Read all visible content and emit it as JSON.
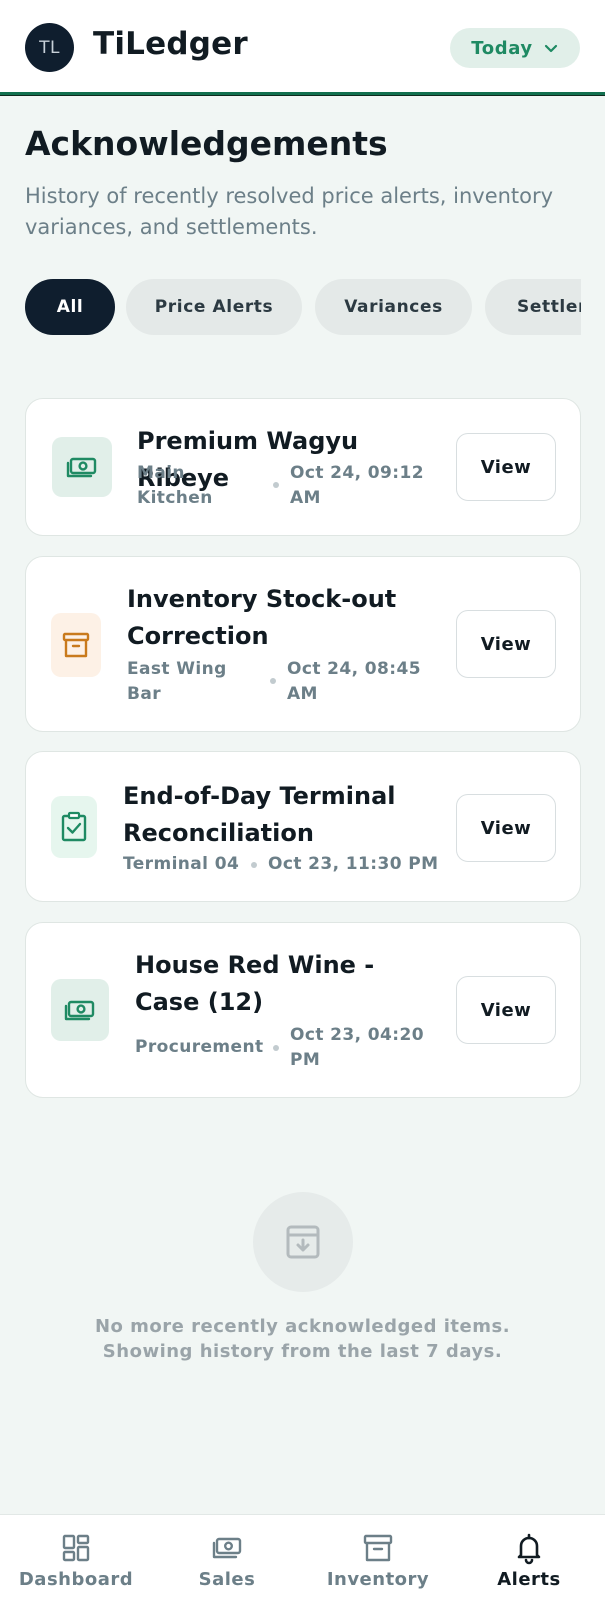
{
  "header": {
    "avatar_initials": "TL",
    "app_title": "TiLedger",
    "date_filter": "Today"
  },
  "page": {
    "title": "Acknowledgements",
    "subtitle": "History of recently resolved price alerts, inventory variances, and settlements."
  },
  "filters": [
    {
      "label": "All",
      "active": true
    },
    {
      "label": "Price Alerts",
      "active": false
    },
    {
      "label": "Variances",
      "active": false
    },
    {
      "label": "Settlements",
      "active": false
    }
  ],
  "items": [
    {
      "title": "Premium Wagyu Ribeye",
      "location": "Main Kitchen",
      "time": "Oct 24, 09:12 AM",
      "icon": "money-icon",
      "action": "View"
    },
    {
      "title": "Inventory Stock-out Correction",
      "location": "East Wing Bar",
      "time": "Oct 24, 08:45 AM",
      "icon": "archive-box-icon",
      "action": "View"
    },
    {
      "title": "End-of-Day Terminal Reconciliation",
      "location": "Terminal 04",
      "time": "Oct 23, 11:30 PM",
      "icon": "clipboard-check-icon",
      "action": "View"
    },
    {
      "title": "House Red Wine - Case (12)",
      "location": "Procurement",
      "time": "Oct 23, 04:20 PM",
      "icon": "money-icon",
      "action": "View"
    }
  ],
  "empty_state": {
    "line1": "No more recently acknowledged items.",
    "line2": "Showing history from the last 7 days."
  },
  "nav": [
    {
      "label": "Dashboard",
      "icon": "dashboard-icon",
      "active": false
    },
    {
      "label": "Sales",
      "icon": "money-icon",
      "active": false
    },
    {
      "label": "Inventory",
      "icon": "archive-box-icon",
      "active": false
    },
    {
      "label": "Alerts",
      "icon": "bell-icon",
      "active": true
    }
  ],
  "colors": {
    "accent": "#1f8a63",
    "dark": "#0f1e2e",
    "price_icon_bg": "#e1efe9",
    "variance_icon": "#c97a1c",
    "variance_icon_bg": "#fdf1e6",
    "settlement_icon_bg": "#e6f6ee"
  }
}
